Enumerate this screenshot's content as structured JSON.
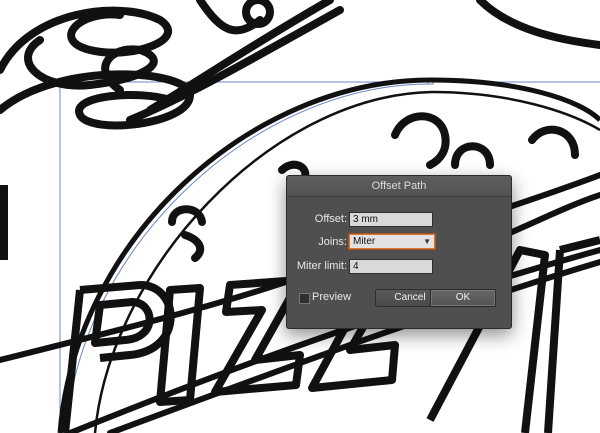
{
  "dialog": {
    "title": "Offset Path",
    "offset_label": "Offset:",
    "offset_value": "3 mm",
    "joins_label": "Joins:",
    "joins_value": "Miter",
    "miter_label": "Miter limit:",
    "miter_value": "4",
    "preview_label": "Preview",
    "preview_checked": false,
    "cancel_label": "Cancel",
    "ok_label": "OK"
  },
  "canvas": {
    "artwork_text": "PIZZA",
    "stroke_color": "#111111",
    "guide_color": "#6a86c9"
  },
  "icons": [
    "chevron-down-icon",
    "checkbox-icon"
  ]
}
